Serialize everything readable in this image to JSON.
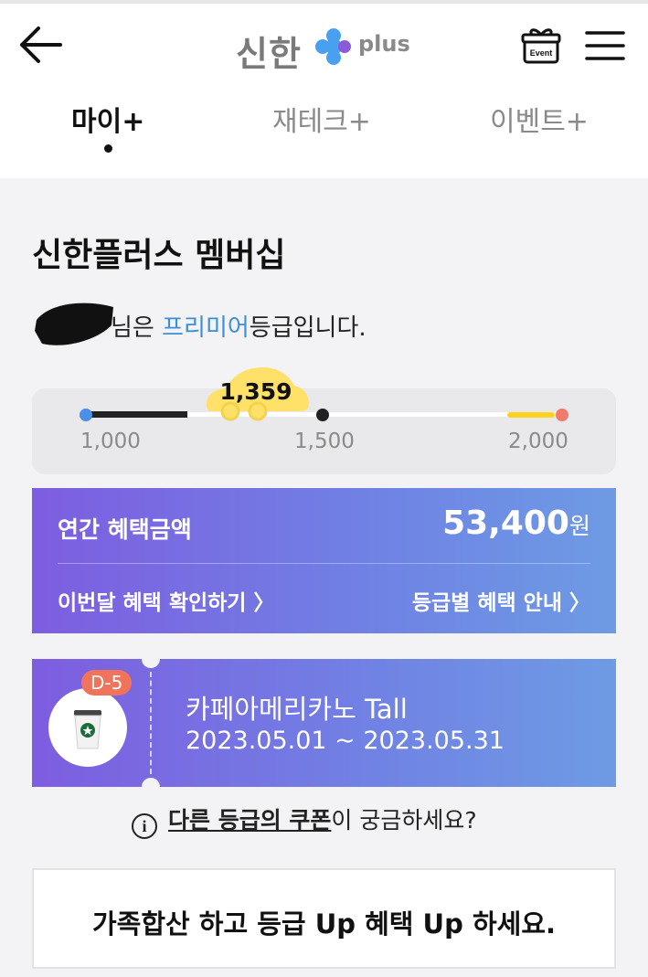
{
  "header": {
    "logo_text": "신한",
    "logo_suffix": "plus",
    "gift_badge": "Event"
  },
  "tabs": [
    {
      "label": "마이+",
      "active": true
    },
    {
      "label": "재테크+",
      "active": false
    },
    {
      "label": "이벤트+",
      "active": false
    }
  ],
  "membership": {
    "title": "신한플러스 멤버십",
    "grade_prefix": "님은 ",
    "grade": "프리미어",
    "grade_suffix": "등급입니다."
  },
  "progress": {
    "current": "1,359",
    "current_value": 1359,
    "min": 1000,
    "max": 2000,
    "ticks": [
      "1,000",
      "1,500",
      "2,000"
    ]
  },
  "benefit": {
    "label": "연간 혜택금액",
    "amount": "53,400",
    "unit": "원",
    "link_left": "이번달 혜택 확인하기 〉",
    "link_right": "등급별 혜택 안내 〉"
  },
  "coupon": {
    "dday": "D-5",
    "name": "카페아메리카노 Tall",
    "period": "2023.05.01 ~ 2023.05.31"
  },
  "info": {
    "icon": "i",
    "link": "다른 등급의 쿠폰",
    "suffix": "이 궁금하세요?"
  },
  "family": {
    "text": "가족합산 하고 등급 Up 혜택 Up 하세요."
  },
  "colors": {
    "grade": "#3b8fd6",
    "gradient_start": "#7e5de0",
    "gradient_end": "#6e9be4",
    "dday": "#f0735c",
    "car": "#ffd21f"
  },
  "icons": [
    "back-arrow-icon",
    "shinhan-plus-logo",
    "gift-event-icon",
    "hamburger-menu-icon",
    "info-icon",
    "coffee-cup-icon",
    "car-icon"
  ]
}
